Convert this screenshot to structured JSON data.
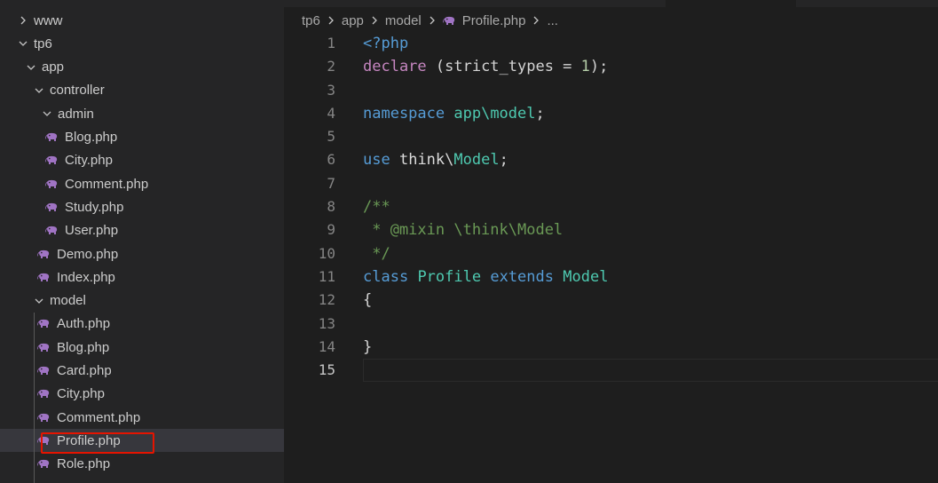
{
  "explorer": {
    "rows": [
      {
        "label": "www",
        "type": "folder",
        "expanded": false,
        "depth": 0
      },
      {
        "label": "tp6",
        "type": "folder",
        "expanded": true,
        "depth": 0
      },
      {
        "label": "app",
        "type": "folder",
        "expanded": true,
        "depth": 1
      },
      {
        "label": "controller",
        "type": "folder",
        "expanded": true,
        "depth": 2
      },
      {
        "label": "admin",
        "type": "folder",
        "expanded": true,
        "depth": 3
      },
      {
        "label": "Blog.php",
        "type": "php",
        "depth": 4
      },
      {
        "label": "City.php",
        "type": "php",
        "depth": 4
      },
      {
        "label": "Comment.php",
        "type": "php",
        "depth": 4
      },
      {
        "label": "Study.php",
        "type": "php",
        "depth": 4
      },
      {
        "label": "User.php",
        "type": "php",
        "depth": 4
      },
      {
        "label": "Demo.php",
        "type": "php",
        "depth": 3
      },
      {
        "label": "Index.php",
        "type": "php",
        "depth": 3
      },
      {
        "label": "model",
        "type": "folder",
        "expanded": true,
        "depth": 2
      },
      {
        "label": "Auth.php",
        "type": "php",
        "depth": 3
      },
      {
        "label": "Blog.php",
        "type": "php",
        "depth": 3
      },
      {
        "label": "Card.php",
        "type": "php",
        "depth": 3
      },
      {
        "label": "City.php",
        "type": "php",
        "depth": 3
      },
      {
        "label": "Comment.php",
        "type": "php",
        "depth": 3
      },
      {
        "label": "Profile.php",
        "type": "php",
        "depth": 3,
        "selected": true
      },
      {
        "label": "Role.php",
        "type": "php",
        "depth": 3
      }
    ],
    "icons": {
      "folder_collapsed": "chevron-right-icon",
      "folder_expanded": "chevron-down-icon",
      "php_file": "php-elephant-icon"
    },
    "highlight_color": "#e51400"
  },
  "breadcrumb": {
    "items": [
      "tp6",
      "app",
      "model",
      "Profile.php",
      "..."
    ],
    "separator_icon": "chevron-right-icon"
  },
  "editor": {
    "current_line": 15,
    "lines": [
      {
        "n": "1",
        "tokens": [
          {
            "c": "tag",
            "t": "<?php"
          }
        ]
      },
      {
        "n": "2",
        "tokens": [
          {
            "c": "kw",
            "t": "declare"
          },
          {
            "c": "plain",
            "t": " (strict_types = "
          },
          {
            "c": "num",
            "t": "1"
          },
          {
            "c": "plain",
            "t": ");"
          }
        ]
      },
      {
        "n": "3",
        "tokens": []
      },
      {
        "n": "4",
        "tokens": [
          {
            "c": "ctl",
            "t": "namespace"
          },
          {
            "c": "plain",
            "t": " "
          },
          {
            "c": "ns",
            "t": "app\\model"
          },
          {
            "c": "plain",
            "t": ";"
          }
        ]
      },
      {
        "n": "5",
        "tokens": []
      },
      {
        "n": "6",
        "tokens": [
          {
            "c": "ctl",
            "t": "use"
          },
          {
            "c": "plain",
            "t": " "
          },
          {
            "c": "id",
            "t": "think"
          },
          {
            "c": "plain",
            "t": "\\"
          },
          {
            "c": "cls",
            "t": "Model"
          },
          {
            "c": "plain",
            "t": ";"
          }
        ]
      },
      {
        "n": "7",
        "tokens": []
      },
      {
        "n": "8",
        "tokens": [
          {
            "c": "cmt",
            "t": "/**"
          }
        ]
      },
      {
        "n": "9",
        "tokens": [
          {
            "c": "cmt",
            "t": " * @mixin \\think\\Model"
          }
        ]
      },
      {
        "n": "10",
        "tokens": [
          {
            "c": "cmt",
            "t": " */"
          }
        ]
      },
      {
        "n": "11",
        "tokens": [
          {
            "c": "ctl",
            "t": "class"
          },
          {
            "c": "plain",
            "t": " "
          },
          {
            "c": "cls",
            "t": "Profile"
          },
          {
            "c": "plain",
            "t": " "
          },
          {
            "c": "ctl",
            "t": "extends"
          },
          {
            "c": "plain",
            "t": " "
          },
          {
            "c": "cls",
            "t": "Model"
          }
        ]
      },
      {
        "n": "12",
        "tokens": [
          {
            "c": "plain",
            "t": "{"
          }
        ]
      },
      {
        "n": "13",
        "tokens": []
      },
      {
        "n": "14",
        "tokens": [
          {
            "c": "plain",
            "t": "}"
          }
        ]
      },
      {
        "n": "15",
        "tokens": []
      }
    ]
  }
}
